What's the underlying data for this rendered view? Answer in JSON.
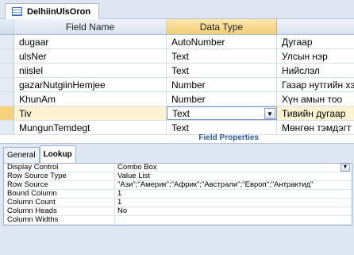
{
  "tab": {
    "title": "DelhiinUlsOron",
    "icon": "table-icon"
  },
  "grid": {
    "headers": {
      "field": "Field Name",
      "type": "Data Type",
      "desc": ""
    },
    "rows": [
      {
        "field": "dugaar",
        "type": "AutoNumber",
        "desc": "Дугаар"
      },
      {
        "field": "ulsNer",
        "type": "Text",
        "desc": "Улсын нэр"
      },
      {
        "field": "niislel",
        "type": "Text",
        "desc": "Нийслэл"
      },
      {
        "field": "gazarNutgiinHemjee",
        "type": "Number",
        "desc": "Газар нутгийн хэ"
      },
      {
        "field": "KhunAm",
        "type": "Number",
        "desc": "Хүн амын тоо"
      },
      {
        "field": "Tiv",
        "type": "Text",
        "desc": "Тивийн дугаар"
      },
      {
        "field": "MungunTemdegt",
        "type": "Text",
        "desc": "Мөнгөн тэмдэгт"
      }
    ],
    "active_row_index": 5
  },
  "field_properties_label": "Field Properties",
  "properties": {
    "tabs": [
      "General",
      "Lookup"
    ],
    "active_tab": "Lookup",
    "rows": [
      {
        "name": "Display Control",
        "value": "Combo Box"
      },
      {
        "name": "Row Source Type",
        "value": "Value List"
      },
      {
        "name": "Row Source",
        "value": "\"Ази\";\"Америк\";\"Африк\";\"Австрали\";\"Европ\";\"Антрактид\""
      },
      {
        "name": "Bound Column",
        "value": "1"
      },
      {
        "name": "Column Count",
        "value": "1"
      },
      {
        "name": "Column Heads",
        "value": "No"
      },
      {
        "name": "Column Widths",
        "value": ""
      }
    ]
  },
  "colors": {
    "header_accent": "#f4cd72",
    "active_row": "#fdf3d2",
    "panel_bg": "#dfe7f2"
  }
}
